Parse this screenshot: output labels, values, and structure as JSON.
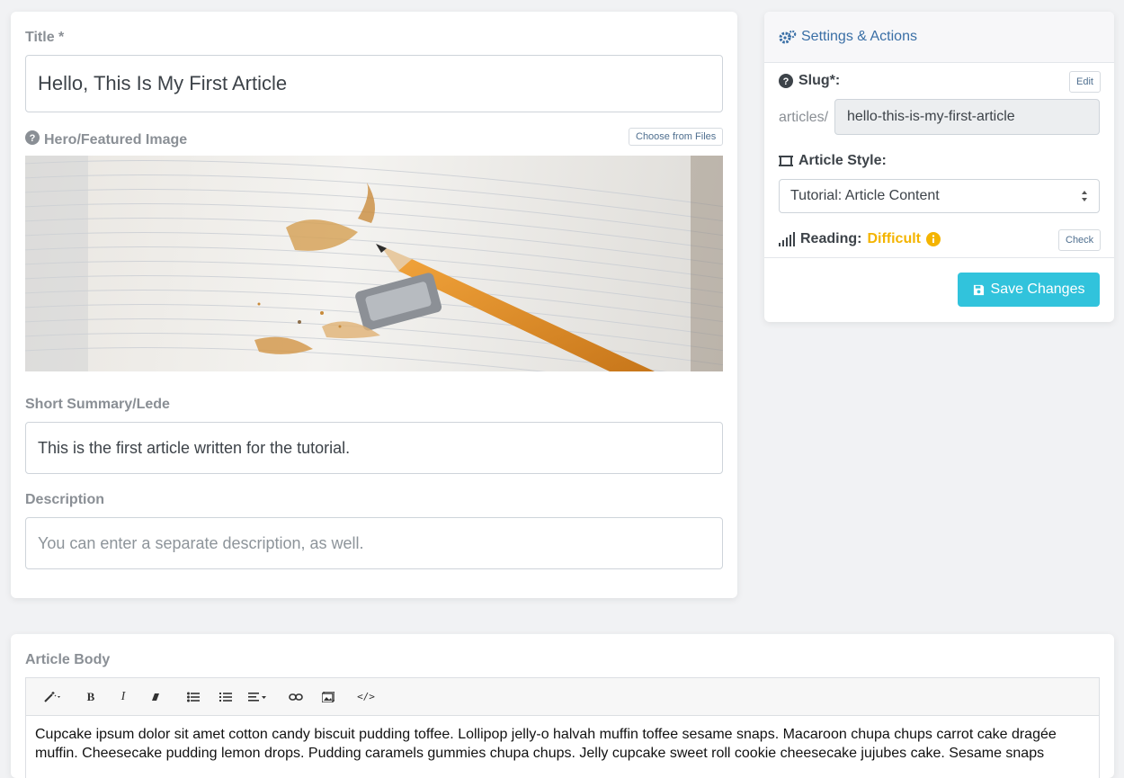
{
  "form": {
    "title_label": "Title *",
    "title_value": "Hello, This Is My First Article",
    "hero_label": "Hero/Featured Image",
    "choose_files_label": "Choose from Files",
    "summary_label": "Short Summary/Lede",
    "summary_value": "This is the first article written for the tutorial.",
    "description_label": "Description",
    "description_placeholder": "You can enter a separate description, as well."
  },
  "settings": {
    "header": "Settings & Actions",
    "slug_label": "Slug*:",
    "edit_label": "Edit",
    "slug_prefix": "articles/",
    "slug_value": "hello-this-is-my-first-article",
    "style_label": "Article Style:",
    "style_value": "Tutorial: Article Content",
    "reading_label": "Reading:",
    "reading_value": "Difficult",
    "check_label": "Check",
    "save_label": "Save Changes"
  },
  "body": {
    "label": "Article Body",
    "text": "Cupcake ipsum dolor sit amet cotton candy biscuit pudding toffee. Lollipop jelly-o halvah muffin toffee sesame snaps. Macaroon chupa chups carrot cake dragée muffin. Cheesecake pudding lemon drops. Pudding caramels gummies chupa chups. Jelly cupcake sweet roll cookie cheesecake jujubes cake. Sesame snaps"
  },
  "colors": {
    "accent": "#31c3dc",
    "link": "#3a6fa6",
    "warning": "#f4b400"
  }
}
